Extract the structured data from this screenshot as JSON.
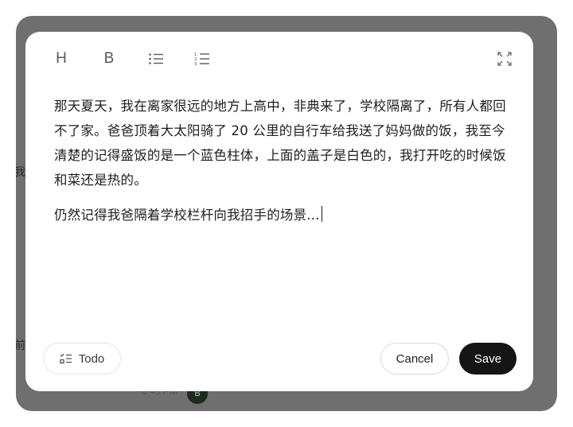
{
  "background": {
    "fragment_1": "我",
    "fragment_2": "前",
    "time": "8:43 PM",
    "avatar": "B"
  },
  "toolbar": {
    "heading_label": "H",
    "bold_label": "B",
    "bullet_list_icon": "bullet-list-icon",
    "numbered_list_icon": "numbered-list-icon",
    "expand_icon": "expand-icon"
  },
  "editor": {
    "paragraph_1": "那天夏天，我在离家很远的地方上高中，非典来了，学校隔离了，所有人都回不了家。爸爸顶着大太阳骑了 20 公里的自行车给我送了妈妈做的饭，我至今清楚的记得盛饭的是一个蓝色柱体，上面的盖子是白色的，我打开吃的时候饭和菜还是热的。",
    "paragraph_2": "仍然记得我爸隔着学校栏杆向我招手的场景..."
  },
  "footer": {
    "todo_label": "Todo",
    "cancel_label": "Cancel",
    "save_label": "Save"
  },
  "colors": {
    "backdrop": "#6f6f6f",
    "modal": "#ffffff",
    "save_button": "#151515"
  }
}
